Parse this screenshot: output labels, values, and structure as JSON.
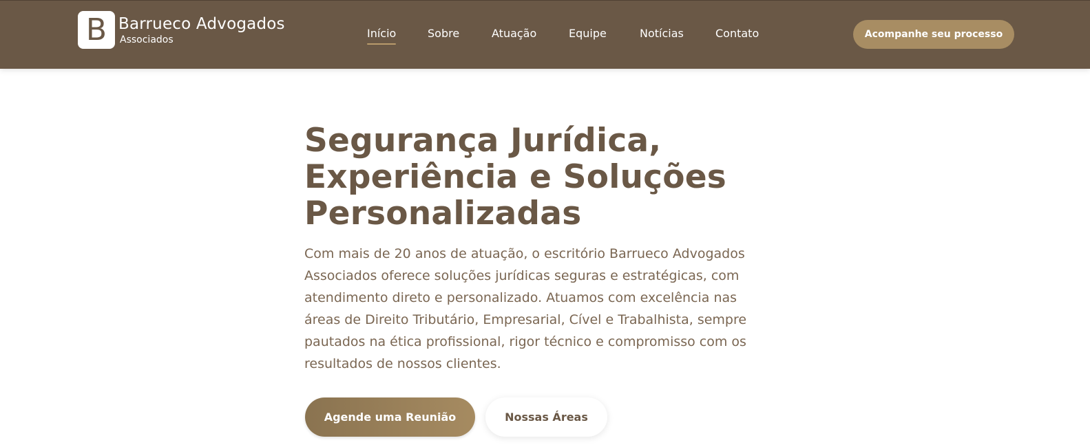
{
  "header": {
    "brand": {
      "logo_letter": "B",
      "name": "Barrueco Advogados",
      "subtitle": "Associados"
    },
    "nav": [
      {
        "label": "Início",
        "active": true
      },
      {
        "label": "Sobre",
        "active": false
      },
      {
        "label": "Atuação",
        "active": false
      },
      {
        "label": "Equipe",
        "active": false
      },
      {
        "label": "Notícias",
        "active": false
      },
      {
        "label": "Contato",
        "active": false
      }
    ],
    "cta_label": "Acompanhe seu processo"
  },
  "hero": {
    "title": "Segurança Jurídica, Experiência e Soluções Personalizadas",
    "description": "Com mais de 20 anos de atuação, o escritório Barrueco Advogados Associados oferece soluções jurídicas seguras e estratégicas, com atendimento direto e personalizado. Atuamos com excelência nas áreas de Direito Tributário, Empresarial, Cível e Trabalhista, sempre pautados na ética profissional, rigor técnico e compromisso com os resultados de nossos clientes.",
    "primary_button": "Agende uma Reunião",
    "secondary_button": "Nossas Áreas"
  },
  "colors": {
    "header_bg": "#6a5846",
    "accent": "#a88d63",
    "title_text": "#6a5846",
    "body_text": "#7a6652"
  }
}
